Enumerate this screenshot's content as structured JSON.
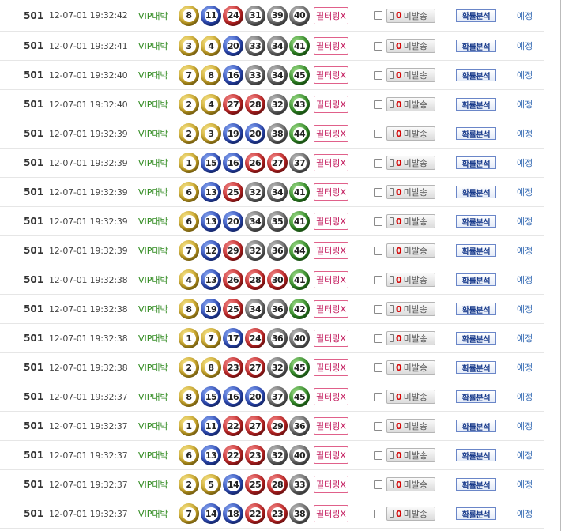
{
  "filter_label": "필터링X",
  "send_label": "미발송",
  "send_count": "0",
  "analysis_label": "확률분석",
  "link_label": "예정",
  "rows": [
    {
      "round": "501",
      "time": "12-07-01 19:32:42",
      "member": "VIP대박",
      "balls": [
        8,
        11,
        24,
        31,
        39,
        40
      ]
    },
    {
      "round": "501",
      "time": "12-07-01 19:32:41",
      "member": "VIP대박",
      "balls": [
        3,
        4,
        20,
        33,
        34,
        41
      ]
    },
    {
      "round": "501",
      "time": "12-07-01 19:32:40",
      "member": "VIP대박",
      "balls": [
        7,
        8,
        16,
        33,
        34,
        45
      ]
    },
    {
      "round": "501",
      "time": "12-07-01 19:32:40",
      "member": "VIP대박",
      "balls": [
        2,
        4,
        27,
        28,
        32,
        43
      ]
    },
    {
      "round": "501",
      "time": "12-07-01 19:32:39",
      "member": "VIP대박",
      "balls": [
        2,
        3,
        19,
        20,
        38,
        44
      ]
    },
    {
      "round": "501",
      "time": "12-07-01 19:32:39",
      "member": "VIP대박",
      "balls": [
        1,
        15,
        16,
        26,
        27,
        37
      ]
    },
    {
      "round": "501",
      "time": "12-07-01 19:32:39",
      "member": "VIP대박",
      "balls": [
        6,
        13,
        25,
        32,
        34,
        41
      ]
    },
    {
      "round": "501",
      "time": "12-07-01 19:32:39",
      "member": "VIP대박",
      "balls": [
        6,
        13,
        20,
        34,
        35,
        41
      ]
    },
    {
      "round": "501",
      "time": "12-07-01 19:32:39",
      "member": "VIP대박",
      "balls": [
        7,
        12,
        29,
        32,
        36,
        44
      ]
    },
    {
      "round": "501",
      "time": "12-07-01 19:32:38",
      "member": "VIP대박",
      "balls": [
        4,
        13,
        26,
        28,
        30,
        41
      ]
    },
    {
      "round": "501",
      "time": "12-07-01 19:32:38",
      "member": "VIP대박",
      "balls": [
        8,
        19,
        25,
        34,
        36,
        42
      ]
    },
    {
      "round": "501",
      "time": "12-07-01 19:32:38",
      "member": "VIP대박",
      "balls": [
        1,
        7,
        17,
        24,
        36,
        40
      ]
    },
    {
      "round": "501",
      "time": "12-07-01 19:32:38",
      "member": "VIP대박",
      "balls": [
        2,
        8,
        23,
        27,
        32,
        45
      ]
    },
    {
      "round": "501",
      "time": "12-07-01 19:32:37",
      "member": "VIP대박",
      "balls": [
        8,
        15,
        16,
        20,
        37,
        45
      ]
    },
    {
      "round": "501",
      "time": "12-07-01 19:32:37",
      "member": "VIP대박",
      "balls": [
        1,
        11,
        22,
        27,
        29,
        36
      ]
    },
    {
      "round": "501",
      "time": "12-07-01 19:32:37",
      "member": "VIP대박",
      "balls": [
        6,
        13,
        22,
        23,
        32,
        40
      ]
    },
    {
      "round": "501",
      "time": "12-07-01 19:32:37",
      "member": "VIP대박",
      "balls": [
        2,
        5,
        14,
        25,
        28,
        33
      ]
    },
    {
      "round": "501",
      "time": "12-07-01 19:32:37",
      "member": "VIP대박",
      "balls": [
        7,
        14,
        18,
        22,
        23,
        38
      ]
    }
  ]
}
